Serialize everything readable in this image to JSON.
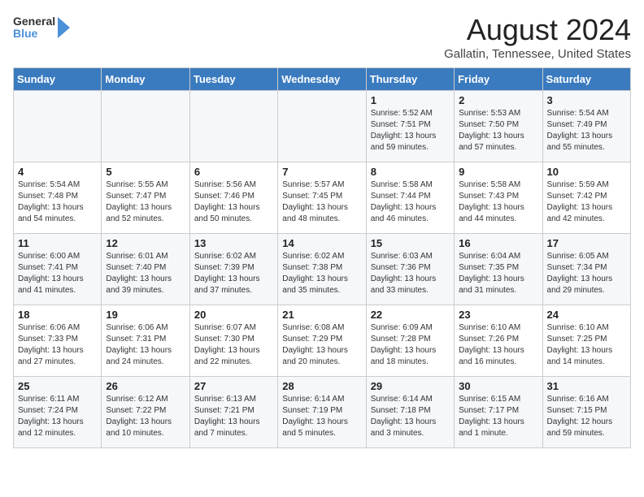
{
  "header": {
    "logo_general": "General",
    "logo_blue": "Blue",
    "month_year": "August 2024",
    "location": "Gallatin, Tennessee, United States"
  },
  "weekdays": [
    "Sunday",
    "Monday",
    "Tuesday",
    "Wednesday",
    "Thursday",
    "Friday",
    "Saturday"
  ],
  "weeks": [
    [
      {
        "day": "",
        "info": ""
      },
      {
        "day": "",
        "info": ""
      },
      {
        "day": "",
        "info": ""
      },
      {
        "day": "",
        "info": ""
      },
      {
        "day": "1",
        "info": "Sunrise: 5:52 AM\nSunset: 7:51 PM\nDaylight: 13 hours\nand 59 minutes."
      },
      {
        "day": "2",
        "info": "Sunrise: 5:53 AM\nSunset: 7:50 PM\nDaylight: 13 hours\nand 57 minutes."
      },
      {
        "day": "3",
        "info": "Sunrise: 5:54 AM\nSunset: 7:49 PM\nDaylight: 13 hours\nand 55 minutes."
      }
    ],
    [
      {
        "day": "4",
        "info": "Sunrise: 5:54 AM\nSunset: 7:48 PM\nDaylight: 13 hours\nand 54 minutes."
      },
      {
        "day": "5",
        "info": "Sunrise: 5:55 AM\nSunset: 7:47 PM\nDaylight: 13 hours\nand 52 minutes."
      },
      {
        "day": "6",
        "info": "Sunrise: 5:56 AM\nSunset: 7:46 PM\nDaylight: 13 hours\nand 50 minutes."
      },
      {
        "day": "7",
        "info": "Sunrise: 5:57 AM\nSunset: 7:45 PM\nDaylight: 13 hours\nand 48 minutes."
      },
      {
        "day": "8",
        "info": "Sunrise: 5:58 AM\nSunset: 7:44 PM\nDaylight: 13 hours\nand 46 minutes."
      },
      {
        "day": "9",
        "info": "Sunrise: 5:58 AM\nSunset: 7:43 PM\nDaylight: 13 hours\nand 44 minutes."
      },
      {
        "day": "10",
        "info": "Sunrise: 5:59 AM\nSunset: 7:42 PM\nDaylight: 13 hours\nand 42 minutes."
      }
    ],
    [
      {
        "day": "11",
        "info": "Sunrise: 6:00 AM\nSunset: 7:41 PM\nDaylight: 13 hours\nand 41 minutes."
      },
      {
        "day": "12",
        "info": "Sunrise: 6:01 AM\nSunset: 7:40 PM\nDaylight: 13 hours\nand 39 minutes."
      },
      {
        "day": "13",
        "info": "Sunrise: 6:02 AM\nSunset: 7:39 PM\nDaylight: 13 hours\nand 37 minutes."
      },
      {
        "day": "14",
        "info": "Sunrise: 6:02 AM\nSunset: 7:38 PM\nDaylight: 13 hours\nand 35 minutes."
      },
      {
        "day": "15",
        "info": "Sunrise: 6:03 AM\nSunset: 7:36 PM\nDaylight: 13 hours\nand 33 minutes."
      },
      {
        "day": "16",
        "info": "Sunrise: 6:04 AM\nSunset: 7:35 PM\nDaylight: 13 hours\nand 31 minutes."
      },
      {
        "day": "17",
        "info": "Sunrise: 6:05 AM\nSunset: 7:34 PM\nDaylight: 13 hours\nand 29 minutes."
      }
    ],
    [
      {
        "day": "18",
        "info": "Sunrise: 6:06 AM\nSunset: 7:33 PM\nDaylight: 13 hours\nand 27 minutes."
      },
      {
        "day": "19",
        "info": "Sunrise: 6:06 AM\nSunset: 7:31 PM\nDaylight: 13 hours\nand 24 minutes."
      },
      {
        "day": "20",
        "info": "Sunrise: 6:07 AM\nSunset: 7:30 PM\nDaylight: 13 hours\nand 22 minutes."
      },
      {
        "day": "21",
        "info": "Sunrise: 6:08 AM\nSunset: 7:29 PM\nDaylight: 13 hours\nand 20 minutes."
      },
      {
        "day": "22",
        "info": "Sunrise: 6:09 AM\nSunset: 7:28 PM\nDaylight: 13 hours\nand 18 minutes."
      },
      {
        "day": "23",
        "info": "Sunrise: 6:10 AM\nSunset: 7:26 PM\nDaylight: 13 hours\nand 16 minutes."
      },
      {
        "day": "24",
        "info": "Sunrise: 6:10 AM\nSunset: 7:25 PM\nDaylight: 13 hours\nand 14 minutes."
      }
    ],
    [
      {
        "day": "25",
        "info": "Sunrise: 6:11 AM\nSunset: 7:24 PM\nDaylight: 13 hours\nand 12 minutes."
      },
      {
        "day": "26",
        "info": "Sunrise: 6:12 AM\nSunset: 7:22 PM\nDaylight: 13 hours\nand 10 minutes."
      },
      {
        "day": "27",
        "info": "Sunrise: 6:13 AM\nSunset: 7:21 PM\nDaylight: 13 hours\nand 7 minutes."
      },
      {
        "day": "28",
        "info": "Sunrise: 6:14 AM\nSunset: 7:19 PM\nDaylight: 13 hours\nand 5 minutes."
      },
      {
        "day": "29",
        "info": "Sunrise: 6:14 AM\nSunset: 7:18 PM\nDaylight: 13 hours\nand 3 minutes."
      },
      {
        "day": "30",
        "info": "Sunrise: 6:15 AM\nSunset: 7:17 PM\nDaylight: 13 hours\nand 1 minute."
      },
      {
        "day": "31",
        "info": "Sunrise: 6:16 AM\nSunset: 7:15 PM\nDaylight: 12 hours\nand 59 minutes."
      }
    ]
  ]
}
